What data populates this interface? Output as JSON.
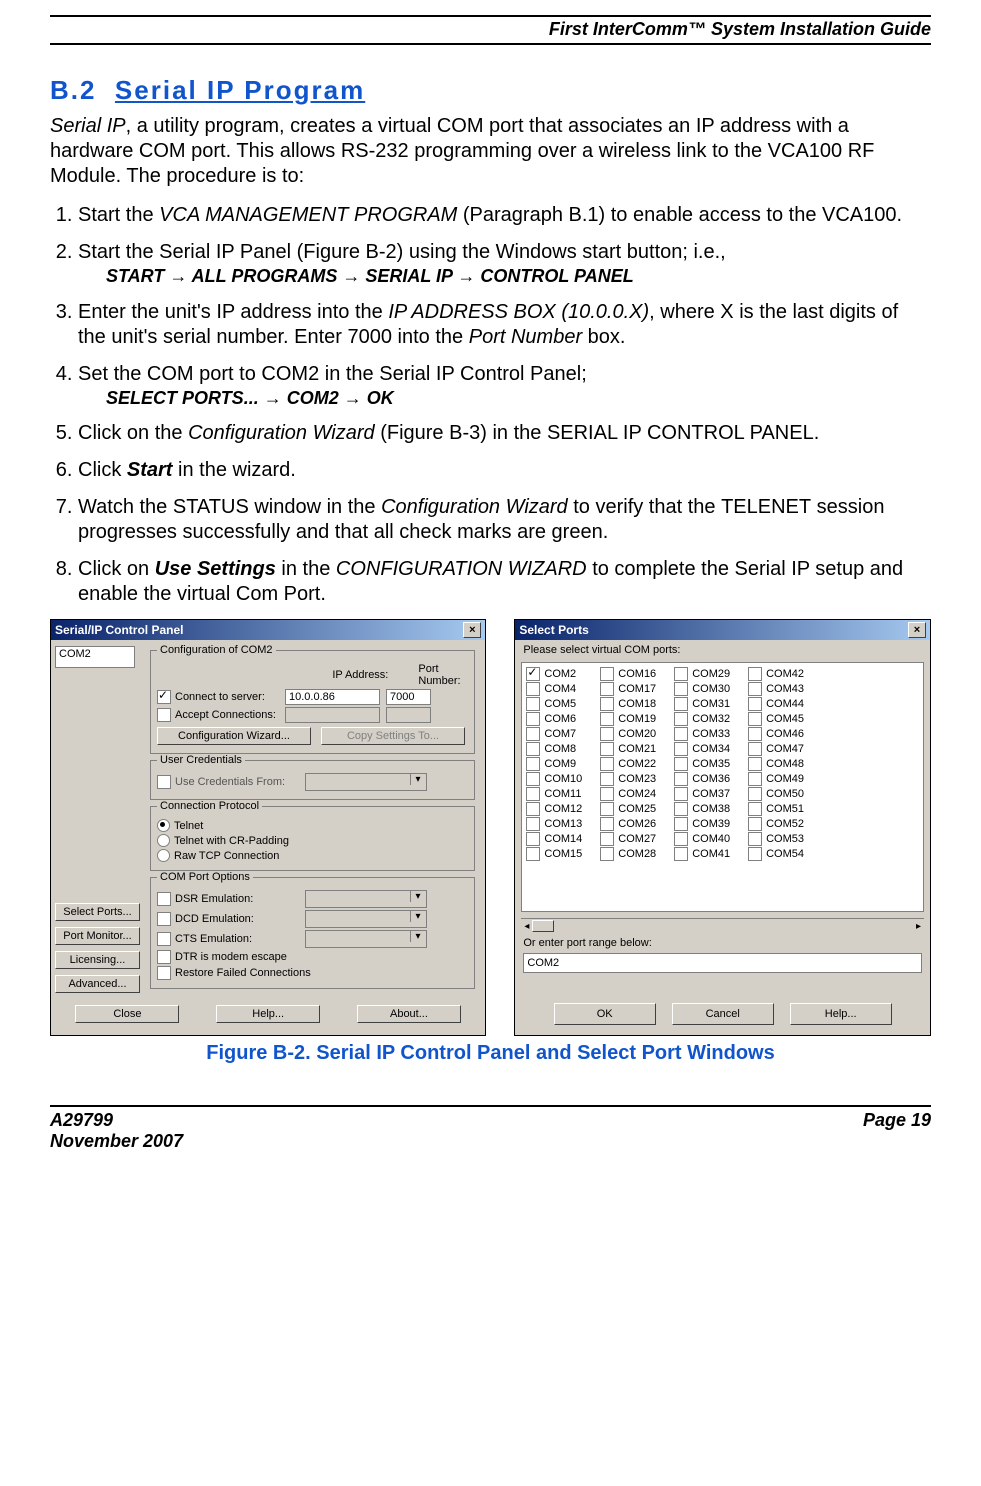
{
  "header": {
    "title": "First InterComm™ System Installation Guide"
  },
  "section": {
    "num": "B.2",
    "title": "Serial IP Program"
  },
  "intro": "Serial IP, a utility program, creates a virtual COM port that associates an IP address with a hardware COM port.  This allows RS-232 programming over a wireless link to the VCA100 RF Module.  The procedure is to:",
  "steps": {
    "s1a": "Start the ",
    "s1b": "VCA MANAGEMENT PROGRAM",
    "s1c": " (Paragraph B.1) to enable access to the VCA100.",
    "s2a": "Start the Serial IP Panel (Figure B-2) using the Windows start button; i.e.,",
    "s2path": "START → ALL PROGRAMS → SERIAL IP → CONTROL PANEL",
    "s3a": "Enter the unit's IP address into the ",
    "s3b": "IP ADDRESS BOX (10.0.0.X)",
    "s3c": ", where X is the last digits of the unit's serial number.  Enter 7000 into the ",
    "s3d": "Port Number",
    "s3e": " box.",
    "s4a": "Set the COM port to COM2 in the Serial IP Control Panel;",
    "s4path": "SELECT PORTS... → COM2 → OK",
    "s5a": "Click on the ",
    "s5b": "Configuration Wizard",
    "s5c": " (Figure B-3) in the ",
    "s5d": "SERIAL IP CONTROL PANEL",
    "s5e": ".",
    "s6a": "Click ",
    "s6b": "Start",
    "s6c": " in the wizard.",
    "s7a": "Watch the ",
    "s7b": "STATUS",
    "s7c": " window in the ",
    "s7d": "Configuration Wizard",
    "s7e": " to verify that the ",
    "s7f": "TELENET",
    "s7g": " session progresses successfully and that all check marks are green.",
    "s8a": "Click on ",
    "s8b": "Use Settings",
    "s8c": " in the ",
    "s8d": "CONFIGURATION WIZARD",
    "s8e": " to complete the Serial IP setup and enable the virtual Com Port."
  },
  "fig_caption": "Figure B-2.  Serial IP Control Panel and Select Port Windows",
  "footer": {
    "left1": "A29799",
    "left2": "November 2007",
    "right": "Page 19"
  },
  "panel": {
    "title": "Serial/IP Control Panel",
    "com_selected": "COM2",
    "group_config": "Configuration of COM2",
    "lbl_ip": "IP Address:",
    "lbl_port": "Port Number:",
    "connect": "Connect to server:",
    "accept": "Accept Connections:",
    "ip_value": "10.0.0.86",
    "port_value": "7000",
    "btn_wizard": "Configuration Wizard...",
    "btn_copy": "Copy Settings To...",
    "group_cred": "User Credentials",
    "use_cred": "Use Credentials From:",
    "group_proto": "Connection Protocol",
    "proto1": "Telnet",
    "proto2": "Telnet with CR-Padding",
    "proto3": "Raw TCP Connection",
    "group_comopt": "COM Port Options",
    "dsr": "DSR Emulation:",
    "dcd": "DCD Emulation:",
    "cts": "CTS Emulation:",
    "dtr": "DTR is modem escape",
    "restore": "Restore Failed Connections",
    "side": {
      "select_ports": "Select Ports...",
      "port_monitor": "Port Monitor...",
      "licensing": "Licensing...",
      "advanced": "Advanced..."
    },
    "bottom": {
      "close": "Close",
      "help": "Help...",
      "about": "About..."
    }
  },
  "selectports": {
    "title": "Select Ports",
    "prompt": "Please select virtual COM ports:",
    "col1": [
      "COM2",
      "COM4",
      "COM5",
      "COM6",
      "COM7",
      "COM8",
      "COM9",
      "COM10",
      "COM11",
      "COM12",
      "COM13",
      "COM14",
      "COM15"
    ],
    "col2": [
      "COM16",
      "COM17",
      "COM18",
      "COM19",
      "COM20",
      "COM21",
      "COM22",
      "COM23",
      "COM24",
      "COM25",
      "COM26",
      "COM27",
      "COM28"
    ],
    "col3": [
      "COM29",
      "COM30",
      "COM31",
      "COM32",
      "COM33",
      "COM34",
      "COM35",
      "COM36",
      "COM37",
      "COM38",
      "COM39",
      "COM40",
      "COM41"
    ],
    "col4": [
      "COM42",
      "COM43",
      "COM44",
      "COM45",
      "COM46",
      "COM47",
      "COM48",
      "COM49",
      "COM50",
      "COM51",
      "COM52",
      "COM53",
      "COM54"
    ],
    "checked": "COM2",
    "range_label": "Or enter port range below:",
    "range_value": "COM2",
    "ok": "OK",
    "cancel": "Cancel",
    "help": "Help..."
  }
}
